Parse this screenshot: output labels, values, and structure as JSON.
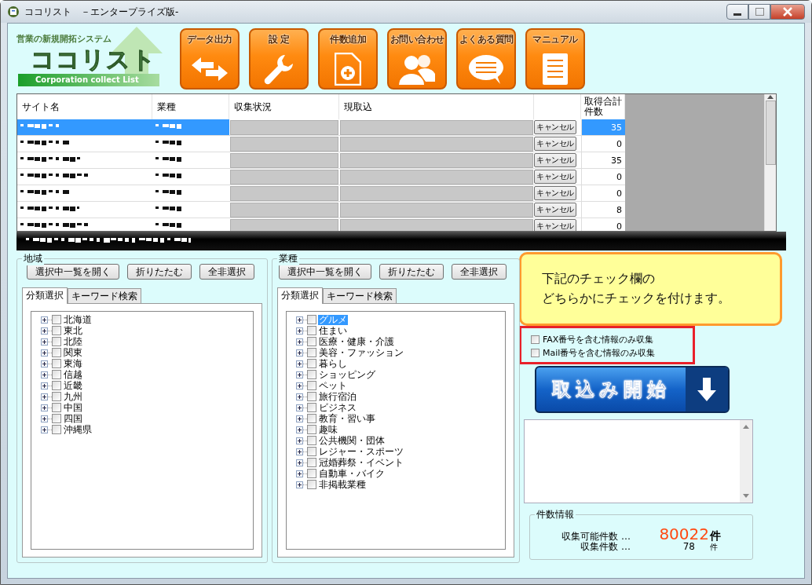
{
  "window": {
    "title": "ココリスト　－エンタープライズ版-"
  },
  "logo": {
    "tagline": "営業の新規開拓システム",
    "name": "ココリスト",
    "subtitle": "Corporation collect List"
  },
  "toolbar": [
    {
      "label": "データ出力",
      "kind": "export"
    },
    {
      "label": "設 定",
      "kind": "settings"
    },
    {
      "label": "件数追加",
      "kind": "add"
    },
    {
      "label": "お問い合わせ",
      "kind": "contact"
    },
    {
      "label": "よくある質問",
      "kind": "faq"
    },
    {
      "label": "マニュアル",
      "kind": "manual"
    }
  ],
  "table": {
    "columns": [
      "サイト名",
      "業種",
      "収集状況",
      "現取込",
      "取得合計件数"
    ],
    "rows": [
      {
        "selected": true,
        "collect": {
          "level": 0
        },
        "current": {
          "level": 0
        },
        "button": "キャンセル",
        "count": "35"
      },
      {
        "selected": false,
        "collect": {
          "level": 0
        },
        "current": {
          "level": 0
        },
        "button": "キャンセル",
        "count": "0"
      },
      {
        "selected": false,
        "collect": {
          "level": 0
        },
        "current": {
          "level": 0
        },
        "button": "キャンセル",
        "count": "35"
      },
      {
        "selected": false,
        "collect": {
          "level": 0
        },
        "current": {
          "level": 0
        },
        "button": "キャンセル",
        "count": "0"
      },
      {
        "selected": false,
        "collect": {
          "level": 0
        },
        "current": {
          "level": 0
        },
        "button": "キャンセル",
        "count": "0"
      },
      {
        "selected": false,
        "collect": {
          "level": 0
        },
        "current": {
          "level": 0
        },
        "button": "キャンセル",
        "count": "8"
      },
      {
        "selected": false,
        "collect": {
          "level": 0
        },
        "current": {
          "level": 0
        },
        "button": "キャンセル",
        "count": "0"
      }
    ]
  },
  "region_panel": {
    "title": "地域",
    "buttons": [
      "選択中一覧を開く",
      "折りたたむ",
      "全非選択"
    ],
    "tabs": [
      {
        "label": "分類選択",
        "selected": true
      },
      {
        "label": "キーワード検索",
        "selected": false
      }
    ],
    "tree": [
      {
        "label": "北海道",
        "checked": false,
        "expanded": false,
        "selected": false
      },
      {
        "label": "東北",
        "checked": false,
        "expanded": false,
        "selected": false
      },
      {
        "label": "北陸",
        "checked": false,
        "expanded": false,
        "selected": false
      },
      {
        "label": "関東",
        "checked": false,
        "expanded": false,
        "selected": false
      },
      {
        "label": "東海",
        "checked": false,
        "expanded": false,
        "selected": false
      },
      {
        "label": "信越",
        "checked": false,
        "expanded": false,
        "selected": false
      },
      {
        "label": "近畿",
        "checked": false,
        "expanded": false,
        "selected": false
      },
      {
        "label": "九州",
        "checked": false,
        "expanded": false,
        "selected": false
      },
      {
        "label": "中国",
        "checked": false,
        "expanded": false,
        "selected": false
      },
      {
        "label": "四国",
        "checked": false,
        "expanded": false,
        "selected": false
      },
      {
        "label": "沖縄県",
        "checked": false,
        "expanded": false,
        "selected": false
      }
    ]
  },
  "industry_panel": {
    "title": "業種",
    "buttons": [
      "選択中一覧を開く",
      "折りたたむ",
      "全非選択"
    ],
    "tabs": [
      {
        "label": "分類選択",
        "selected": true
      },
      {
        "label": "キーワード検索",
        "selected": false
      }
    ],
    "tree": [
      {
        "label": "グルメ",
        "checked": false,
        "expanded": false,
        "selected": true
      },
      {
        "label": "住まい",
        "checked": false,
        "expanded": false,
        "selected": false
      },
      {
        "label": "医療・健康・介護",
        "checked": false,
        "expanded": false,
        "selected": false
      },
      {
        "label": "美容・ファッション",
        "checked": false,
        "expanded": false,
        "selected": false
      },
      {
        "label": "暮らし",
        "checked": false,
        "expanded": false,
        "selected": false
      },
      {
        "label": "ショッピング",
        "checked": false,
        "expanded": false,
        "selected": false
      },
      {
        "label": "ペット",
        "checked": false,
        "expanded": false,
        "selected": false
      },
      {
        "label": "旅行宿泊",
        "checked": false,
        "expanded": false,
        "selected": false
      },
      {
        "label": "ビジネス",
        "checked": false,
        "expanded": false,
        "selected": false
      },
      {
        "label": "教育・習い事",
        "checked": false,
        "expanded": false,
        "selected": false
      },
      {
        "label": "趣味",
        "checked": false,
        "expanded": false,
        "selected": false
      },
      {
        "label": "公共機関・団体",
        "checked": false,
        "expanded": false,
        "selected": false
      },
      {
        "label": "レジャー・スポーツ",
        "checked": false,
        "expanded": false,
        "selected": false
      },
      {
        "label": "冠婚葬祭・イベント",
        "checked": false,
        "expanded": false,
        "selected": false
      },
      {
        "label": "自動車・バイク",
        "checked": false,
        "expanded": false,
        "selected": false
      },
      {
        "label": "非掲載業種",
        "checked": false,
        "expanded": false,
        "selected": false
      }
    ]
  },
  "notice": {
    "lines": [
      "下記のチェック欄の",
      "どちらかにチェックを付けます。"
    ]
  },
  "filters": [
    {
      "label": "FAX番号を含む情報のみ収集",
      "checked": false
    },
    {
      "label": "Mail番号を含む情報のみ収集",
      "checked": false
    }
  ],
  "start_button": {
    "label": "取込み開始"
  },
  "count_info": {
    "title": "件数情報",
    "rows": [
      {
        "label": "収集可能件数 …",
        "value": "80022",
        "unit": "件",
        "kind": "highlight"
      },
      {
        "label": "収集件数 …",
        "value": "78",
        "unit": "件",
        "kind": "plain"
      }
    ]
  }
}
